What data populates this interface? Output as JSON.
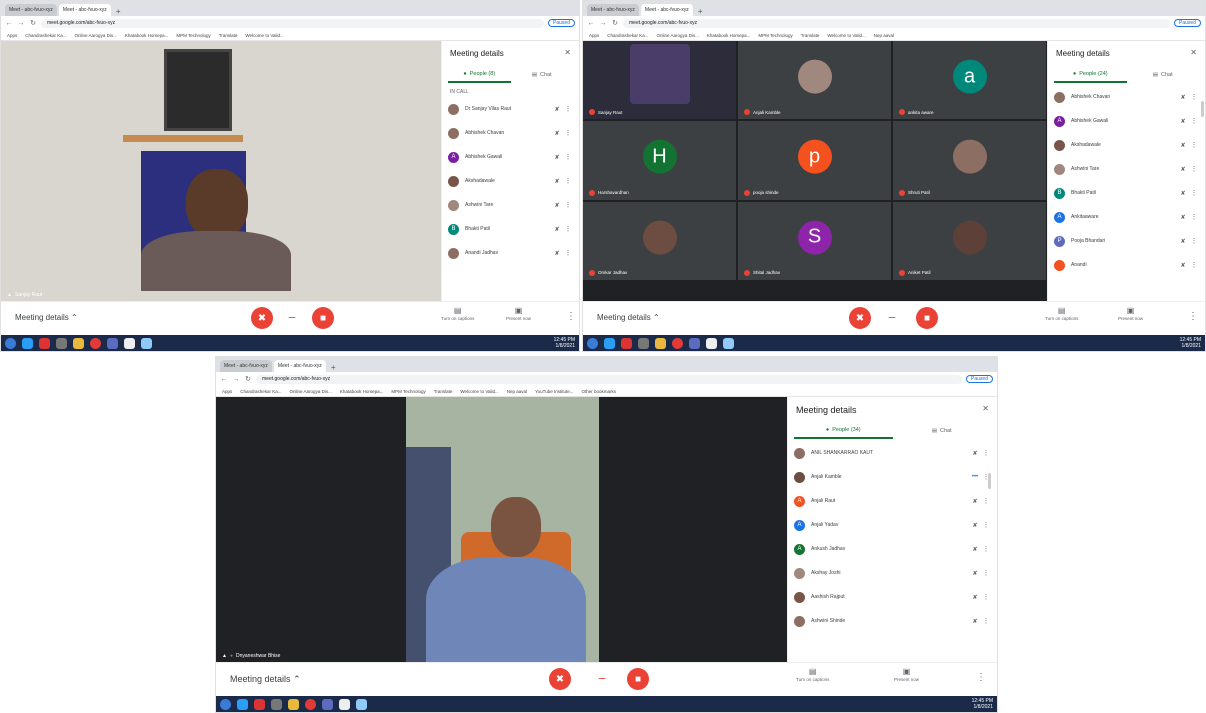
{
  "browser": {
    "tab_1": "Meet - abc-fvuo-xyz",
    "tab_2": "Meet - abc-fvuo-xyz",
    "new_tab": "+",
    "url": "meet.google.com/abc-fvuo-xyz",
    "paused": "Paused",
    "bookmarks": [
      "Apps",
      "Chandrashekar Ka...",
      "Online Aarogya Dis...",
      "Khatabook Homepa...",
      "MPM Technology",
      "Translate",
      "Welcome to Valid...",
      "Nep aaval",
      "YouTube Institute...",
      "Other bookmarks"
    ]
  },
  "colors": {
    "accent": "#137333",
    "danger": "#ea4335",
    "taskbar": "#1c2a4a",
    "stage": "#202124"
  },
  "shot1": {
    "panel_title": "Meeting details",
    "tab_people": "People (8)",
    "tab_chat": "Chat",
    "in_meeting": "IN CALL",
    "participants": [
      {
        "name": "Dr Sanjay Vilas Raut",
        "color": "#8d6e63"
      },
      {
        "name": "Abhishek Chavan",
        "color": "#8d6e63"
      },
      {
        "name": "Abhishek Gawali",
        "color": "#7b1fa2",
        "initial": "A"
      },
      {
        "name": "Akshadawale",
        "color": "#795548"
      },
      {
        "name": "Ashwini Tare",
        "color": "#a1887f"
      },
      {
        "name": "Bhakti Patil",
        "color": "#00897b",
        "initial": "B"
      },
      {
        "name": "Anandi Jadhav",
        "color": "#8d6e63"
      }
    ],
    "self_name": "Sanjay Raut",
    "meeting_details": "Meeting details"
  },
  "shot2": {
    "panel_title": "Meeting details",
    "tab_people": "People (24)",
    "tab_chat": "Chat",
    "participants": [
      {
        "name": "Abhishek Chavan",
        "color": "#8d6e63"
      },
      {
        "name": "Abhishek Gawali",
        "color": "#7b1fa2",
        "initial": "A"
      },
      {
        "name": "Akshadawale",
        "color": "#795548"
      },
      {
        "name": "Ashwini Tare",
        "color": "#a1887f"
      },
      {
        "name": "Bhakti Patil",
        "color": "#00897b",
        "initial": "B"
      },
      {
        "name": "Ankitaaware",
        "color": "#1a73e8",
        "initial": "A"
      },
      {
        "name": "Pooja Bhandari",
        "color": "#5c6bc0",
        "initial": "P"
      },
      {
        "name": "Anandi",
        "color": "#f4511e"
      }
    ],
    "tiles": [
      {
        "name": "Sanjay Raut",
        "avatar": "",
        "color": "#3c4043"
      },
      {
        "name": "Anjali Kamble",
        "avatar": "",
        "color": "#a1887f"
      },
      {
        "name": "ankita aware",
        "avatar": "a",
        "color": "#00897b"
      },
      {
        "name": "Harshavardhan",
        "avatar": "H",
        "color": "#137333"
      },
      {
        "name": "pooja shinde",
        "avatar": "p",
        "color": "#f4511e"
      },
      {
        "name": "Shruti Patil",
        "avatar": "",
        "color": "#8d6e63"
      },
      {
        "name": "Omkar Jadhav",
        "avatar": "",
        "color": "#6d4c41"
      },
      {
        "name": "Shital Jadhav",
        "avatar": "S",
        "color": "#8e24aa"
      },
      {
        "name": "Aniket Patil",
        "avatar": "",
        "color": "#5d4037"
      }
    ],
    "meeting_details": "Meeting details"
  },
  "shot3": {
    "panel_title": "Meeting details",
    "tab_people": "People (34)",
    "tab_chat": "Chat",
    "participants": [
      {
        "name": "ANIL SHANKARRAO KAUT",
        "color": "#8d6e63"
      },
      {
        "name": "Anjali Kamble",
        "color": "#6d4c41",
        "speaking": "•••"
      },
      {
        "name": "Anjali Raut",
        "color": "#f4511e",
        "initial": "A"
      },
      {
        "name": "Anjali Yadav",
        "color": "#1a73e8",
        "initial": "A"
      },
      {
        "name": "Ankush Jadhav",
        "color": "#137333",
        "initial": "A"
      },
      {
        "name": "Akshay Joshi",
        "color": "#a1887f"
      },
      {
        "name": "Aashish Rajput",
        "color": "#795548"
      },
      {
        "name": "Ashwini Shinde",
        "color": "#8d6e63"
      }
    ],
    "presenter": "Dnyaneshwar Bhise",
    "meeting_details": "Meeting details"
  },
  "controls": {
    "mic_icon": "mic-off-icon",
    "cam_icon": "videocam-off-icon",
    "captions": "Turn on captions",
    "present": "Present now"
  },
  "taskbar": {
    "time": "12:45 PM",
    "date": "1/8/2021"
  }
}
